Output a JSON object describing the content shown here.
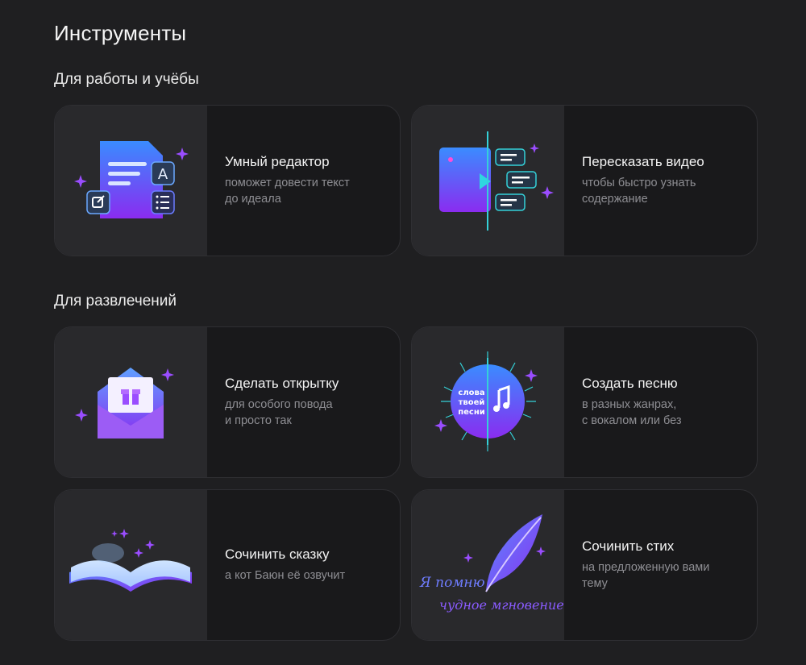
{
  "page": {
    "title": "Инструменты"
  },
  "sections": [
    {
      "title": "Для работы и учёбы",
      "cards": [
        {
          "title": "Умный редактор",
          "subtitle": "поможет довести текст\nдо идеала",
          "icon": "document-editor-icon"
        },
        {
          "title": "Пересказать видео",
          "subtitle": "чтобы быстро узнать\nсодержание",
          "icon": "video-summary-icon"
        }
      ]
    },
    {
      "title": "Для развлечений",
      "cards": [
        {
          "title": "Сделать открытку",
          "subtitle": "для особого повода\nи просто так",
          "icon": "gift-envelope-icon"
        },
        {
          "title": "Создать песню",
          "subtitle": "в разных жанрах,\nс вокалом или без",
          "icon": "song-disc-icon",
          "badge": "слова\nтвоей\nпесни"
        },
        {
          "title": "Сочинить сказку",
          "subtitle": "а кот Баюн её озвучит",
          "icon": "open-book-icon"
        },
        {
          "title": "Сочинить стих",
          "subtitle": "на предложенную вами\nтему",
          "icon": "quill-icon",
          "script_text": [
            "Я помню",
            "чудное мгновение"
          ]
        }
      ]
    }
  ],
  "colors": {
    "background": "#1f1f21",
    "card": "#19191b",
    "card_art": "#29292c",
    "accent_purple": "#8b3dff",
    "accent_teal": "#34d1d8"
  }
}
